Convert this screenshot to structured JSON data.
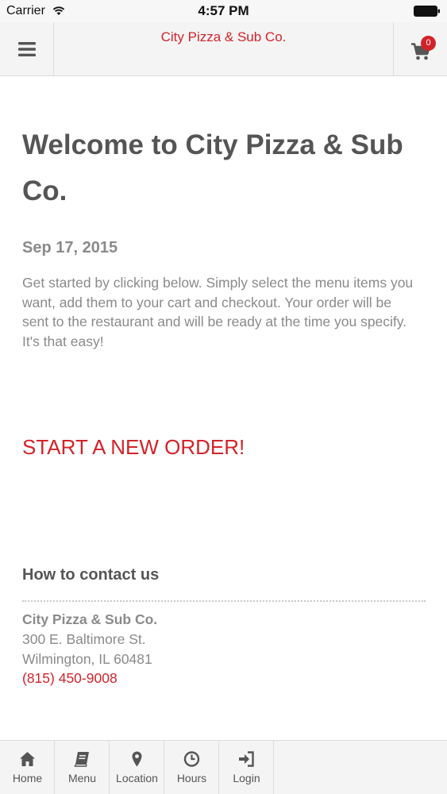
{
  "status_bar": {
    "carrier": "Carrier",
    "time": "4:57 PM",
    "wifi_icon": "wifi-icon",
    "battery_icon": "battery-icon"
  },
  "header": {
    "title": "City Pizza & Sub Co.",
    "menu_icon": "hamburger-icon",
    "cart_icon": "cart-icon",
    "cart_count": "0"
  },
  "main": {
    "title": "Welcome to City Pizza & Sub Co.",
    "date": "Sep 17, 2015",
    "intro": "Get started by clicking below. Simply select the menu items you want, add them to your cart and checkout. Your order will be sent to the restaurant and will be ready at the time you specify. It's that easy!",
    "cta_label": "START A NEW ORDER!"
  },
  "contact": {
    "heading": "How to contact us",
    "name": "City Pizza & Sub Co.",
    "street": "300 E. Baltimore St.",
    "city_line": "Wilmington, IL 60481",
    "phone": "(815) 450-9008"
  },
  "tab_bar": {
    "tabs": [
      {
        "label": "Home",
        "icon": "home-icon"
      },
      {
        "label": "Menu",
        "icon": "book-icon"
      },
      {
        "label": "Location",
        "icon": "map-marker-icon"
      },
      {
        "label": "Hours",
        "icon": "clock-icon"
      },
      {
        "label": "Login",
        "icon": "sign-in-icon"
      }
    ]
  },
  "colors": {
    "accent": "#d2232a",
    "heading": "#555555",
    "body_text": "#8a8a8a",
    "bar_background": "#f4f4f4"
  }
}
